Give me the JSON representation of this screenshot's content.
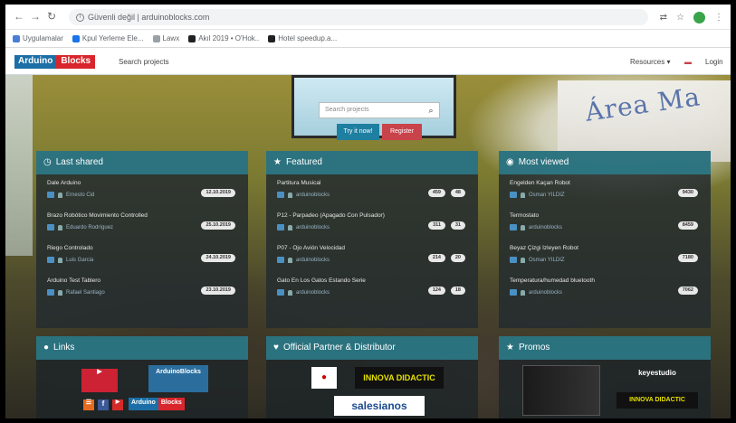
{
  "browser": {
    "url": "Güvenli değil | arduinoblocks.com",
    "bookmarks": [
      {
        "label": "Uygulamalar",
        "color": "#4a7ed6"
      },
      {
        "label": "Kpul Yerleme Ele...",
        "color": "#1a73e8"
      },
      {
        "label": "Lawx",
        "color": "#9aa0a6"
      },
      {
        "label": "Akıl 2019 • O'Hok..",
        "color": "#202124"
      },
      {
        "label": "Hotel speedup.a...",
        "color": "#202124"
      }
    ]
  },
  "site": {
    "logo_part1": "Arduino",
    "logo_part2": "Blocks",
    "nav_search": "Search projects",
    "nav_resources": "Resources ▾",
    "nav_login": "Login",
    "search_placeholder": "Search projects",
    "try_label": "Try it now!",
    "register_label": "Register",
    "mural_text": "Área Ma"
  },
  "panels": {
    "last_shared": {
      "title": "Last shared",
      "items": [
        {
          "title": "Dale Arduino",
          "author": "Ernesto Cid",
          "badge": "12.10.2019"
        },
        {
          "title": "Brazo Robótico Movimiento Controlled",
          "author": "Eduardo Rodríguez",
          "badge": "25.10.2019"
        },
        {
          "title": "Riego Controlado",
          "author": "Luis Garcia",
          "badge": "24.10.2019"
        },
        {
          "title": "Arduino Test Tablero",
          "author": "Rafael Santiago",
          "badge": "23.10.2019"
        }
      ]
    },
    "featured": {
      "title": "Featured",
      "items": [
        {
          "title": "Partitura Musical",
          "author": "arduinoblocks",
          "badge1": "459",
          "badge2": "48"
        },
        {
          "title": "P12 - Parpadeo (Apagado Con Pulsador)",
          "author": "arduinoblocks",
          "badge1": "311",
          "badge2": "31"
        },
        {
          "title": "P07 - Ojo Avión Velocidad",
          "author": "arduinoblocks",
          "badge1": "214",
          "badge2": "20"
        },
        {
          "title": "Gato En Los Gatos Estando Serie",
          "author": "arduinoblocks",
          "badge1": "124",
          "badge2": "18"
        }
      ]
    },
    "most_viewed": {
      "title": "Most viewed",
      "items": [
        {
          "title": "Engelden Kaçan Robot",
          "author": "Osman YILDIZ",
          "badge": "9430"
        },
        {
          "title": "Termostato",
          "author": "arduinoblocks",
          "badge": "8459"
        },
        {
          "title": "Beyaz Çizgi İzleyen Robot",
          "author": "Osman YILDIZ",
          "badge": "7180"
        },
        {
          "title": "Temperatura/humedad bluetooth",
          "author": "arduinoblocks",
          "badge": "7062"
        }
      ]
    },
    "links": {
      "title": "Links",
      "logo_name": "ArduinoBlocks"
    },
    "partner": {
      "title": "Official Partner & Distributor",
      "brand1": "INNOVA DIDACTIC",
      "brand2": "salesianos"
    },
    "promos": {
      "title": "Promos",
      "brand": "keyestudio",
      "brand2": "INNOVA DIDACTIC"
    }
  },
  "colors": {
    "panel_header": "#2d7887",
    "try_button": "#1f7fa0",
    "register_button": "#c9434a",
    "logo_blue": "#1c6fa6",
    "logo_red": "#d8262c"
  }
}
